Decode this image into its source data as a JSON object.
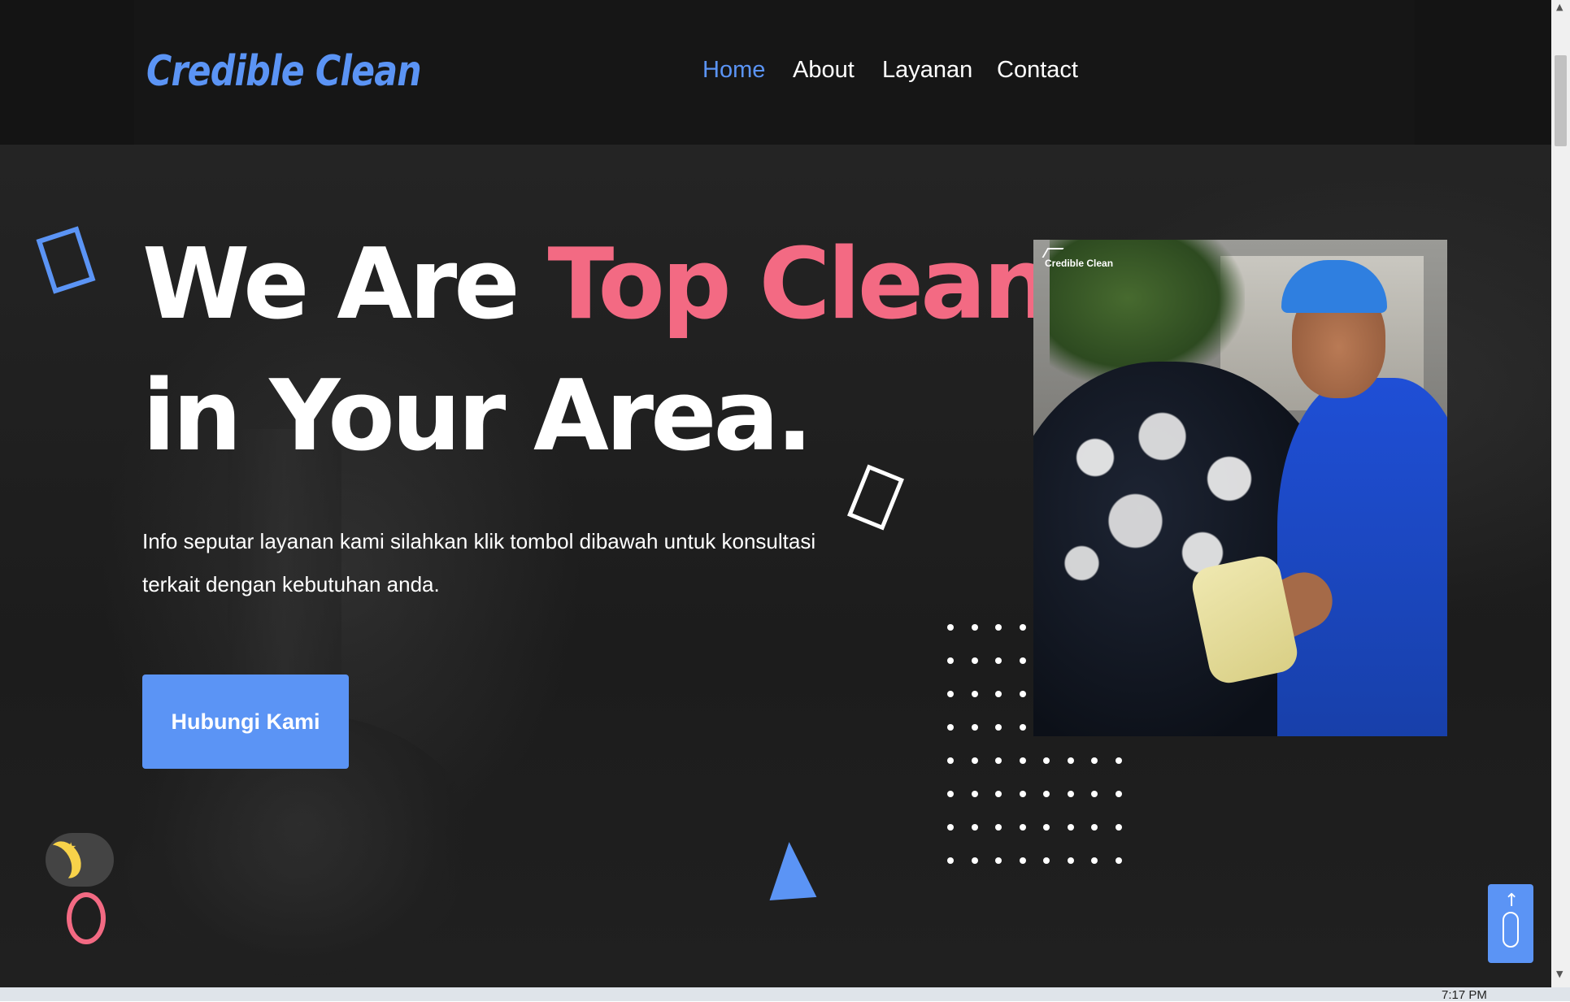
{
  "brand": {
    "logo_text": "Credible Clean",
    "accent_color": "#5b94f5",
    "highlight_color": "#f36a83"
  },
  "nav": {
    "items": [
      {
        "label": "Home",
        "active": true
      },
      {
        "label": "About",
        "active": false
      },
      {
        "label": "Layanan",
        "active": false
      },
      {
        "label": "Contact",
        "active": false
      }
    ]
  },
  "hero": {
    "headline_part1": "We Are ",
    "headline_accent": "Top Cleaner",
    "headline_part2": "in Your Area.",
    "description": "Info seputar layanan kami silahkan klik tombol dibawah untuk konsultasi terkait dengan kebutuhan anda.",
    "cta_label": "Hubungi Kami",
    "image_watermark": "Credible Clean"
  },
  "widgets": {
    "theme_toggle_icon": "moon-icon",
    "back_to_top_icon": "mouse-scroll-icon"
  },
  "system": {
    "clock": "7:17 PM"
  }
}
